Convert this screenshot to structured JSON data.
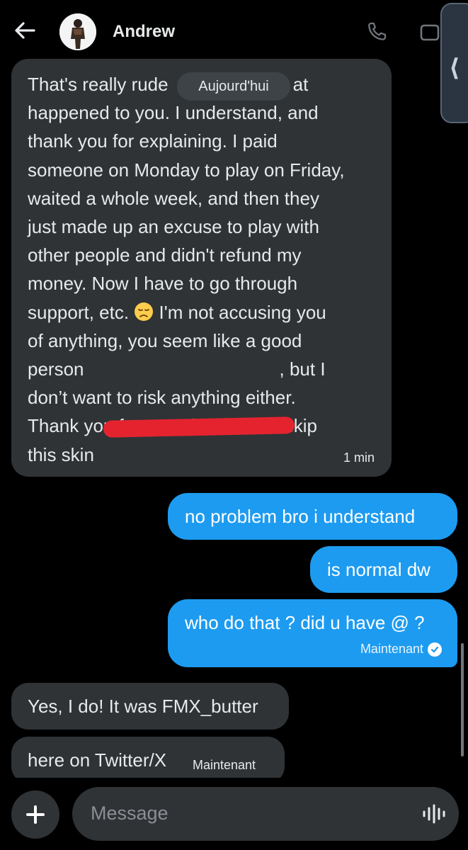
{
  "header": {
    "contact_name": "Andrew"
  },
  "date_separator": "Aujourd'hui",
  "messages": {
    "long_incoming": {
      "lines": [
        "That's really rude",
        "at",
        "happened to you. I understand, and",
        "thank you for explaining. I paid",
        "someone on Monday to play on Friday,",
        "waited a whole week, and then they",
        "just made up an excuse to play with",
        "other people and didn't refund my",
        "money. Now I have to go through",
        "support, etc.",
        "I'm not accusing you",
        "of anything, you seem like a good",
        "person",
        ", but I",
        "don’t want to risk anything either.",
        "Thank you for your time, but I’ll skip",
        "this skin"
      ],
      "time": "1 min"
    },
    "outgoing_1": "no problem bro i understand",
    "outgoing_2": "is normal dw",
    "outgoing_3": "who do that ? did u have @ ?",
    "outgoing_3_status": "Maintenant",
    "incoming_2": "Yes, I do! It was FMX_butter",
    "incoming_3": "here on Twitter/X",
    "incoming_3_time": "Maintenant"
  },
  "composer": {
    "placeholder": "Message"
  },
  "icons": {
    "back": "arrow-left-icon",
    "call": "phone-icon",
    "video": "video-icon",
    "side_tab": "chevron-left-icon",
    "emoji": "disappointed-face-emoji",
    "read": "check-circle-icon",
    "add": "plus-icon",
    "voice": "waveform-icon"
  },
  "colors": {
    "background": "#000000",
    "incoming_bubble": "#2f3336",
    "outgoing_bubble": "#1d9bf0",
    "redaction": "#e5232f"
  }
}
